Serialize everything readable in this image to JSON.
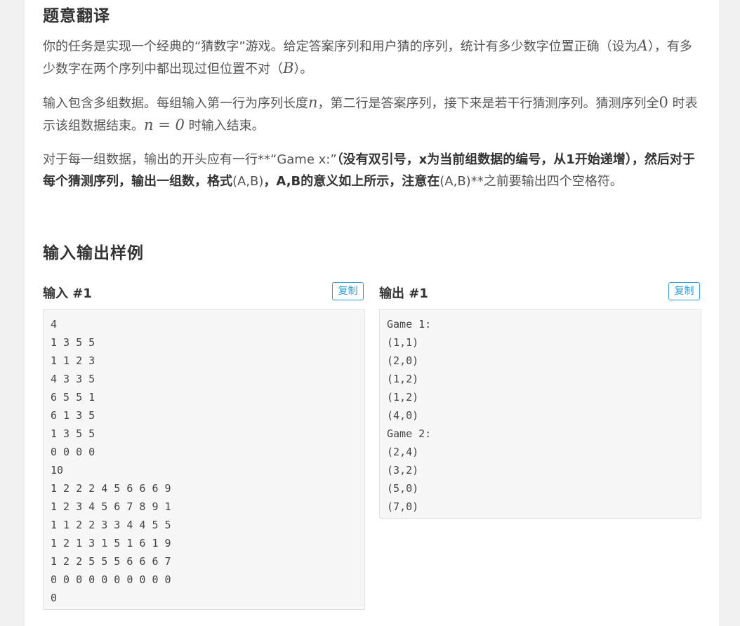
{
  "description": {
    "title": "题意翻译",
    "p1_a": "你的任务是实现一个经典的“猜数字”游戏。给定答案序列和用户猜的序列，统计有多少数字位置正确（设为",
    "p1_var_a": "A",
    "p1_b": "），有多少数字在两个序列中都出现过但位置不对（",
    "p1_var_b": "B",
    "p1_c": "）。",
    "p2_a": "输入包含多组数据。每组输入第一行为序列长度",
    "p2_var_n": "n",
    "p2_b": "，第二行是答案序列，接下来是若干行猜测序列。猜测序列全",
    "p2_zero": "0",
    "p2_c": "时表示该组数据结束。",
    "p2_math": "n = 0",
    "p2_d": "时输入结束。",
    "p3_a": "对于每一组数据，输出的开头应有一行**“Game x:”",
    "p3_bold1": "（没有双引号，x为当前组数据的编号，从1开始递增），然后对于每个猜测序列，输出一组数，格式",
    "p3_mid": "(A,B)",
    "p3_bold2": "，A,B的意义如上所示，注意在",
    "p3_end": "(A,B)**之前要输出四个空格符。"
  },
  "samples": {
    "title": "输入输出样例",
    "copy_label": "复制",
    "input": {
      "label": "输入 #1",
      "lines": [
        "4",
        "1 3 5 5",
        "1 1 2 3",
        "4 3 3 5",
        "6 5 5 1",
        "6 1 3 5",
        "1 3 5 5",
        "0 0 0 0",
        "10",
        "1 2 2 2 4 5 6 6 6 9",
        "1 2 3 4 5 6 7 8 9 1",
        "1 1 2 2 3 3 4 4 5 5",
        "1 2 1 3 1 5 1 6 1 9",
        "1 2 2 5 5 5 6 6 6 7",
        "0 0 0 0 0 0 0 0 0 0",
        "0"
      ]
    },
    "output": {
      "label": "输出 #1",
      "lines": [
        "Game 1:",
        "(1,1)",
        "(2,0)",
        "(1,2)",
        "(1,2)",
        "(4,0)",
        "Game 2:",
        "(2,4)",
        "(3,2)",
        "(5,0)",
        "(7,0)"
      ]
    }
  }
}
